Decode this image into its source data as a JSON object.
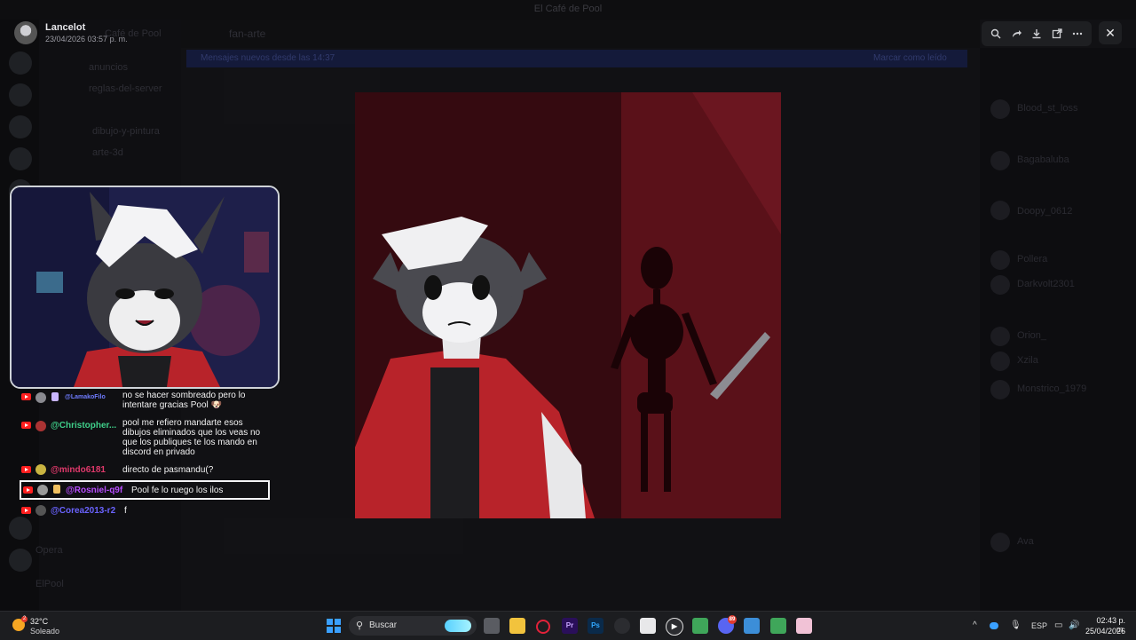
{
  "background_window": {
    "title": "El Café de Pool",
    "server_name": "Café de Pool",
    "channel_header": "fan-arte",
    "banner_left": "Mensajes nuevos desde las 14:37",
    "banner_right": "Marcar como leído",
    "channels": [
      "anuncios",
      "reglas-del-server",
      "dibujo-y-pintura",
      "arte-3d"
    ],
    "voice_channel": "Opera",
    "bottom_user": "ElPool",
    "members": [
      "Blood_st_loss",
      "Bagabaluba",
      "Doopy_0612",
      "Pollera",
      "Darkvolt2301",
      "Orion_",
      "Xzila",
      "Monstrico_1979",
      "Ava"
    ]
  },
  "viewer": {
    "username": "Lancelot",
    "timestamp": "23/04/2026 03:57 p. m.",
    "toolbar_icons": [
      "zoom-icon",
      "forward-icon",
      "download-icon",
      "open-external-icon",
      "more-icon"
    ],
    "close_label": "✕"
  },
  "stream": {
    "chat": [
      {
        "platform": "youtube",
        "user": "@LamakoFilo",
        "user_color": "#6f7cff",
        "message": "no se hacer sombreado pero lo intentare gracias Pool 🐶"
      },
      {
        "platform": "youtube",
        "user": "@Christopher...",
        "user_color": "#3fd08a",
        "message": "pool me refiero mandarte esos dibujos eliminados que los veas no que los publiques te los mando en discord en privado"
      },
      {
        "platform": "youtube",
        "user": "@mindo6181",
        "user_color": "#e0396b",
        "message": "directo de pasmandu(?"
      },
      {
        "platform": "youtube",
        "user": "@Rosniel-q9f",
        "user_color": "#b84dff",
        "message": "Pool fe lo ruego los ilos",
        "highlighted": true
      },
      {
        "platform": "youtube",
        "user": "@Corea2013-r2",
        "user_color": "#6a63ff",
        "message": "f"
      }
    ]
  },
  "taskbar": {
    "weather_temp": "32°C",
    "weather_condition": "Soleado",
    "weather_badge": "2",
    "search_placeholder": "Buscar",
    "language": "ESP",
    "time": "02:43 p. m.",
    "date": "25/04/2026",
    "discord_badge": "89",
    "apps": [
      "task-view",
      "file-explorer",
      "opera",
      "premiere-pro",
      "photoshop",
      "app-6",
      "app-7",
      "media-player",
      "app-9",
      "discord",
      "app-11",
      "app-12",
      "app-13"
    ]
  }
}
